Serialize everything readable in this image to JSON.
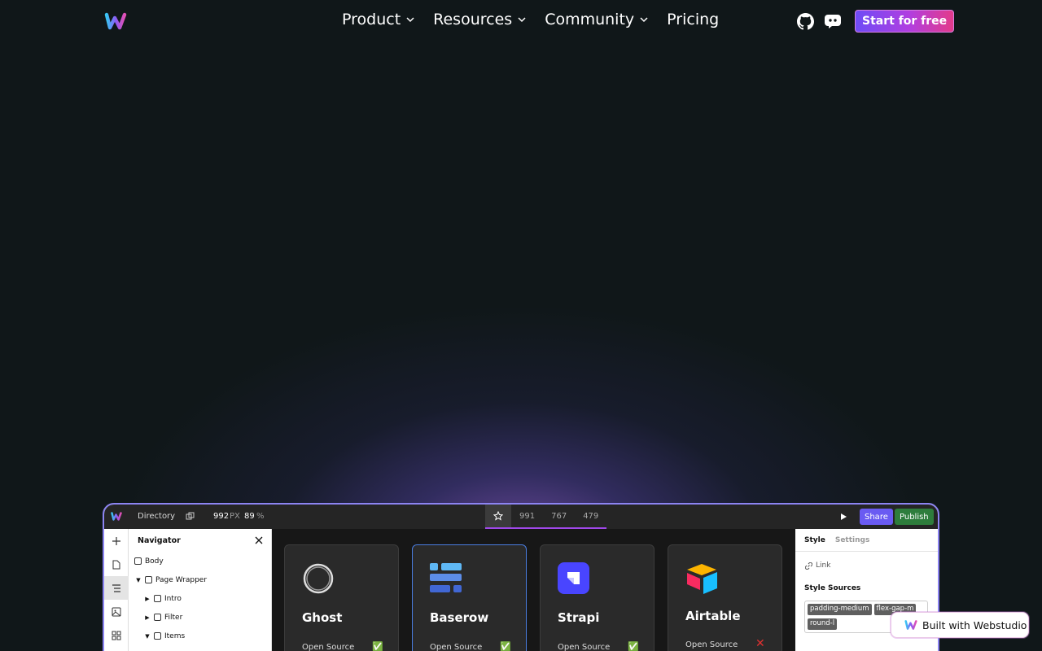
{
  "nav": {
    "menu": [
      {
        "label": "Product",
        "has_dropdown": true
      },
      {
        "label": "Resources",
        "has_dropdown": true
      },
      {
        "label": "Community",
        "has_dropdown": true
      },
      {
        "label": "Pricing",
        "has_dropdown": false
      }
    ],
    "icons": [
      "github-icon",
      "discord-icon"
    ],
    "cta_label": "Start for free"
  },
  "app": {
    "page_label": "Directory",
    "width_value": "992",
    "width_unit": "PX",
    "zoom_value": "89",
    "zoom_unit": "%",
    "breakpoints": [
      "991",
      "767",
      "479"
    ],
    "share_label": "Share",
    "publish_label": "Publish",
    "navigator": {
      "title": "Navigator",
      "tree": [
        {
          "label": "Body",
          "depth": 0,
          "expander": ""
        },
        {
          "label": "Page Wrapper",
          "depth": 0,
          "expander": "▼"
        },
        {
          "label": "Intro",
          "depth": 1,
          "expander": "▶"
        },
        {
          "label": "Filter",
          "depth": 1,
          "expander": "▶"
        },
        {
          "label": "Items",
          "depth": 1,
          "expander": "▼"
        }
      ]
    },
    "cards": [
      {
        "title": "Ghost",
        "subtitle": "Open Source",
        "mark": "✅",
        "mark_color": "#3bbf4a",
        "icon": "ghost-logo-icon"
      },
      {
        "title": "Baserow",
        "subtitle": "Open Source",
        "mark": "✅",
        "mark_color": "#3bbf4a",
        "icon": "baserow-logo-icon"
      },
      {
        "title": "Strapi",
        "subtitle": "Open Source",
        "mark": "✅",
        "mark_color": "#3bbf4a",
        "icon": "strapi-logo-icon"
      },
      {
        "title": "Airtable",
        "subtitle": "Open Source",
        "mark": "✕",
        "mark_color": "#e03030",
        "icon": "airtable-logo-icon"
      }
    ],
    "style_panel": {
      "tabs": [
        "Style",
        "Settings"
      ],
      "link_label": "Link",
      "sources_title": "Style Sources",
      "tokens": [
        "padding-medium",
        "flex-gap-m",
        "round-l"
      ]
    }
  },
  "badge_label": "Built with Webstudio",
  "colors": {
    "background": "#101719",
    "accent_purple": "#6e4cf6",
    "accent_pink": "#e33b8a",
    "publish_green": "#2e7d3c"
  }
}
